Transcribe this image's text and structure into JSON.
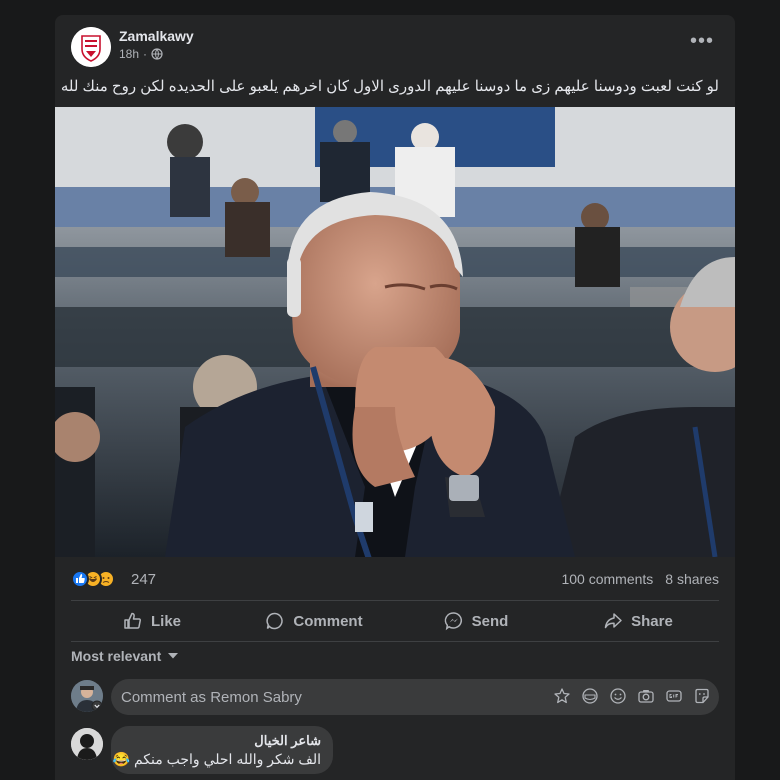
{
  "post": {
    "page_name": "Zamalkawy",
    "time": "18h",
    "privacy_icon": "globe-icon",
    "text": "لو كنت لعبت ودوسنا عليهم  زى ما دوسنا عليهم الدورى الاول كان اخرهم يلعبو على الحديده  لكن روح منك لله"
  },
  "reactions": {
    "icons": [
      "like-icon",
      "haha-icon",
      "sad-icon"
    ],
    "count": "247",
    "comments": "100 comments",
    "shares": "8 shares"
  },
  "actions": {
    "like": "Like",
    "comment": "Comment",
    "send": "Send",
    "share": "Share"
  },
  "comments_section": {
    "sort_label": "Most relevant",
    "composer_placeholder": "Comment as Remon Sabry",
    "items": [
      {
        "author": "شاعر الخيال",
        "text": "الف شكر والله احلي واجب منكم 😂"
      }
    ]
  },
  "colors": {
    "background": "#18191a",
    "card": "#242526",
    "bubble": "#3a3b3c",
    "text": "#e4e6eb",
    "secondary_text": "#b0b3b8",
    "like_blue": "#1877f2"
  }
}
